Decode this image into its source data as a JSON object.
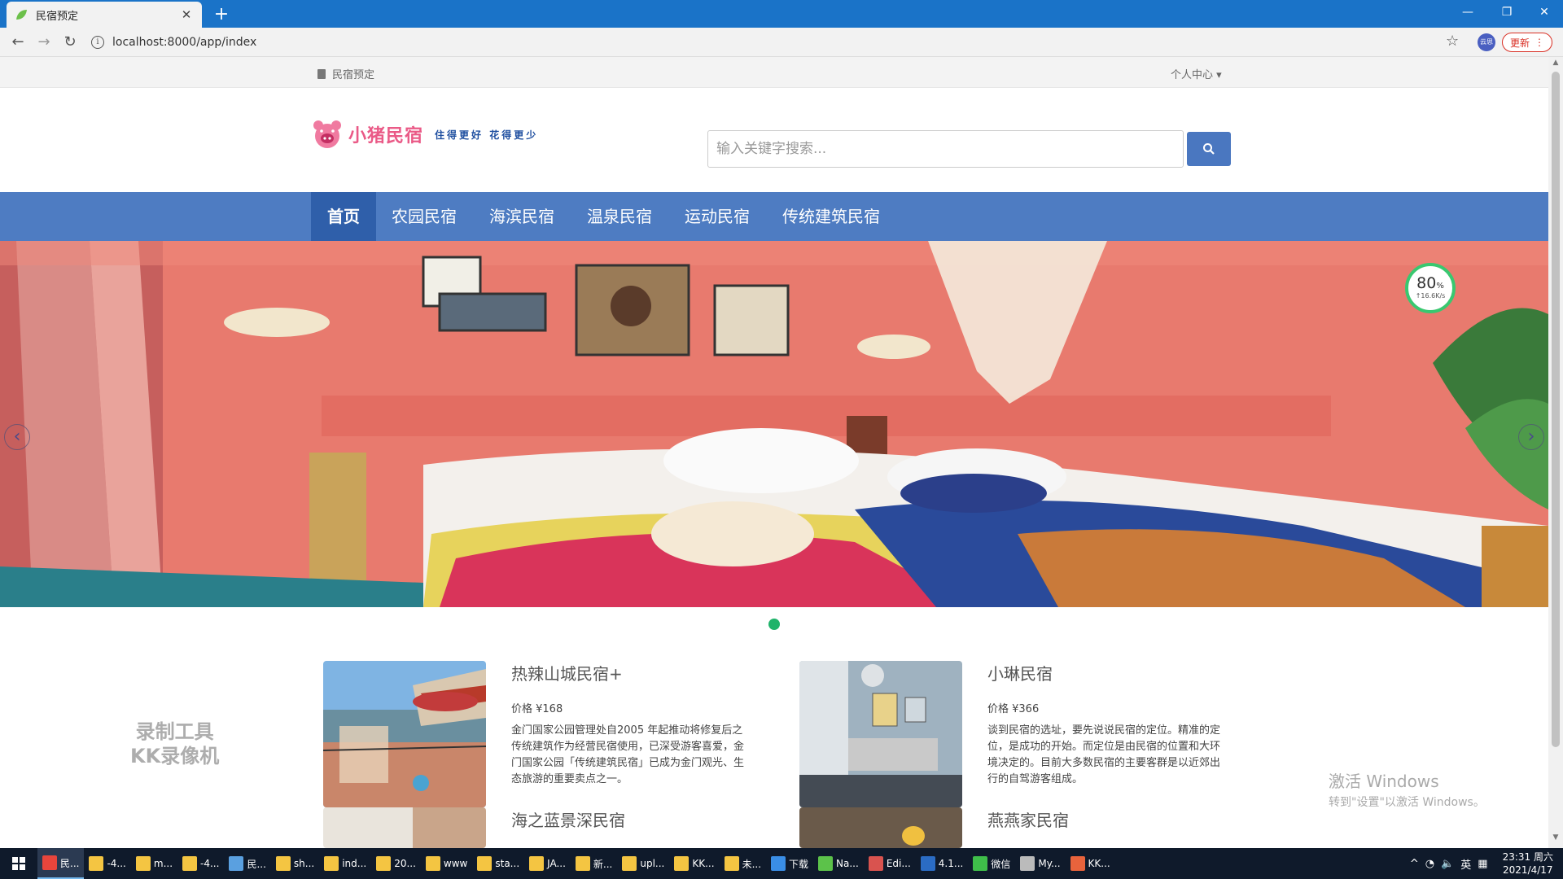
{
  "browser": {
    "tab_title": "民宿预定",
    "url": "localhost:8000/app/index",
    "update_label": "更新",
    "profile_label": "云思"
  },
  "topbar": {
    "home_label": "民宿预定",
    "user_menu": "个人中心 ▾"
  },
  "logo": {
    "name": "小猪民宿",
    "slogan": "住得更好 花得更少"
  },
  "search": {
    "placeholder": "输入关键字搜索..."
  },
  "nav": {
    "items": [
      {
        "label": "首页"
      },
      {
        "label": "农园民宿"
      },
      {
        "label": "海滨民宿"
      },
      {
        "label": "温泉民宿"
      },
      {
        "label": "运动民宿"
      },
      {
        "label": "传统建筑民宿"
      }
    ]
  },
  "speed_widget": {
    "percent": "80",
    "unit": "%",
    "rate": "↑16.6K/s"
  },
  "listings": [
    {
      "title": "热辣山城民宿+",
      "price": "价格 ¥168",
      "desc": "金门国家公园管理处自2005 年起推动将修复后之传统建筑作为经营民宿使用，已深受游客喜爱，金门国家公园「传统建筑民宿」已成为金门观光、生态旅游的重要卖点之一。"
    },
    {
      "title": "小琳民宿",
      "price": "价格 ¥366",
      "desc": "谈到民宿的选址，要先说说民宿的定位。精准的定位，是成功的开始。而定位是由民宿的位置和大环境决定的。目前大多数民宿的主要客群是以近郊出行的自驾游客组成。"
    },
    {
      "title": "海之蓝景深民宿"
    },
    {
      "title": "燕燕家民宿"
    }
  ],
  "watermark": {
    "line1": "录制工具",
    "line2": "KK录像机"
  },
  "activate": {
    "line1": "激活 Windows",
    "line2": "转到\"设置\"以激活 Windows。"
  },
  "taskbar": {
    "items": [
      {
        "label": "民...",
        "color": "#e8453c"
      },
      {
        "label": "-4...",
        "color": "#f4c542"
      },
      {
        "label": "m...",
        "color": "#f4c542"
      },
      {
        "label": "-4...",
        "color": "#f4c542"
      },
      {
        "label": "民...",
        "color": "#5aa0e0"
      },
      {
        "label": "sh...",
        "color": "#f4c542"
      },
      {
        "label": "ind...",
        "color": "#f4c542"
      },
      {
        "label": "20...",
        "color": "#f4c542"
      },
      {
        "label": "www",
        "color": "#f4c542"
      },
      {
        "label": "sta...",
        "color": "#f4c542"
      },
      {
        "label": "JA...",
        "color": "#f4c542"
      },
      {
        "label": "新...",
        "color": "#f4c542"
      },
      {
        "label": "upl...",
        "color": "#f4c542"
      },
      {
        "label": "KK...",
        "color": "#f4c542"
      },
      {
        "label": "未...",
        "color": "#f4c542"
      },
      {
        "label": "下载",
        "color": "#3a8ee6"
      },
      {
        "label": "Na...",
        "color": "#5cc24a"
      },
      {
        "label": "Edi...",
        "color": "#d9534f"
      },
      {
        "label": "4.1...",
        "color": "#2b6cc4"
      },
      {
        "label": "微信",
        "color": "#3fbf4a"
      },
      {
        "label": "My...",
        "color": "#bbbbbb"
      },
      {
        "label": "KK...",
        "color": "#e8633c"
      }
    ],
    "ime": "英",
    "time": "23:31 周六",
    "date": "2021/4/17"
  }
}
